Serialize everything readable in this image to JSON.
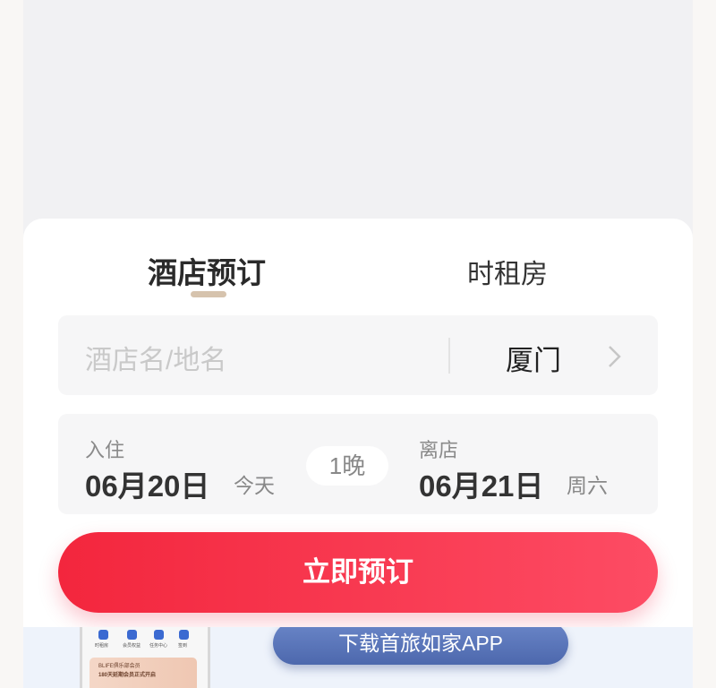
{
  "tabs": {
    "hotel_booking": "酒店预订",
    "hourly_room": "时租房"
  },
  "search": {
    "placeholder": "酒店名/地名",
    "city": "厦门"
  },
  "dates": {
    "checkin_label": "入住",
    "checkin_date": "06月20日",
    "checkin_day": "今天",
    "nights": "1晚",
    "checkout_label": "离店",
    "checkout_date": "06月21日",
    "checkout_day": "周六"
  },
  "book_button": "立即预订",
  "banner": {
    "download_button": "下载首旅如家APP",
    "phone": {
      "icons": [
        "时租房",
        "会员权益",
        "任务中心",
        "签到"
      ],
      "card_line1": "BLIFE俱乐部会员",
      "card_line2": "180天延期会员正式开启"
    }
  },
  "colors": {
    "accent": "#f3263d",
    "tab_indicator": "#d6c3ad",
    "app_button": "#5570b4"
  },
  "icons": {
    "city_chevron": "chevron-right-icon"
  }
}
